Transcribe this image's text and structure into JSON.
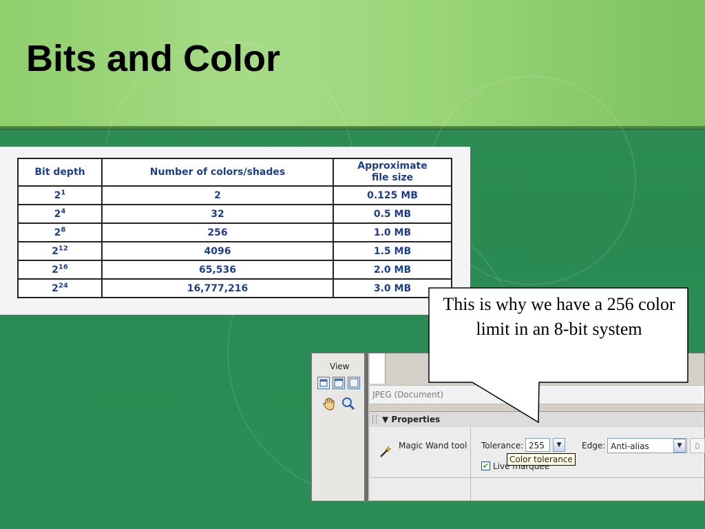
{
  "slide": {
    "title": "Bits and Color"
  },
  "table": {
    "headers": [
      "Bit depth",
      "Number of colors/shades",
      "Approximate file size"
    ],
    "rows": [
      {
        "base": "2",
        "exp": "1",
        "colors": "2",
        "size": "0.125 MB"
      },
      {
        "base": "2",
        "exp": "4",
        "colors": "32",
        "size": "0.5 MB"
      },
      {
        "base": "2",
        "exp": "8",
        "colors": "256",
        "size": "1.0 MB"
      },
      {
        "base": "2",
        "exp": "12",
        "colors": "4096",
        "size": "1.5 MB"
      },
      {
        "base": "2",
        "exp": "16",
        "colors": "65,536",
        "size": "2.0 MB"
      },
      {
        "base": "2",
        "exp": "24",
        "colors": "16,777,216",
        "size": "3.0 MB"
      }
    ]
  },
  "callout": {
    "text": "This is why we have a 256 color limit in an 8-bit system"
  },
  "screenshot": {
    "view_label": "View",
    "document_label": "JPEG (Document)",
    "properties_label": "▼ Properties",
    "tool_name": "Magic Wand tool",
    "tolerance_label": "Tolerance:",
    "tolerance_value": "255",
    "edge_label": "Edge:",
    "edge_value": "Anti-alias",
    "disabled_field_value": "0",
    "live_marquee_label": "Live marquee",
    "live_marquee_checked": true,
    "tooltip": "Color tolerance",
    "icons": [
      "standard-mode-icon",
      "full-screen-menus-icon",
      "full-screen-icon",
      "hand-icon",
      "zoom-icon",
      "magic-wand-icon"
    ]
  },
  "colors": {
    "title_band": "#9bd67a",
    "background_green": "#2b8d56",
    "table_text": "#1d3f8a",
    "tooltip_bg": "#ffffe1"
  }
}
